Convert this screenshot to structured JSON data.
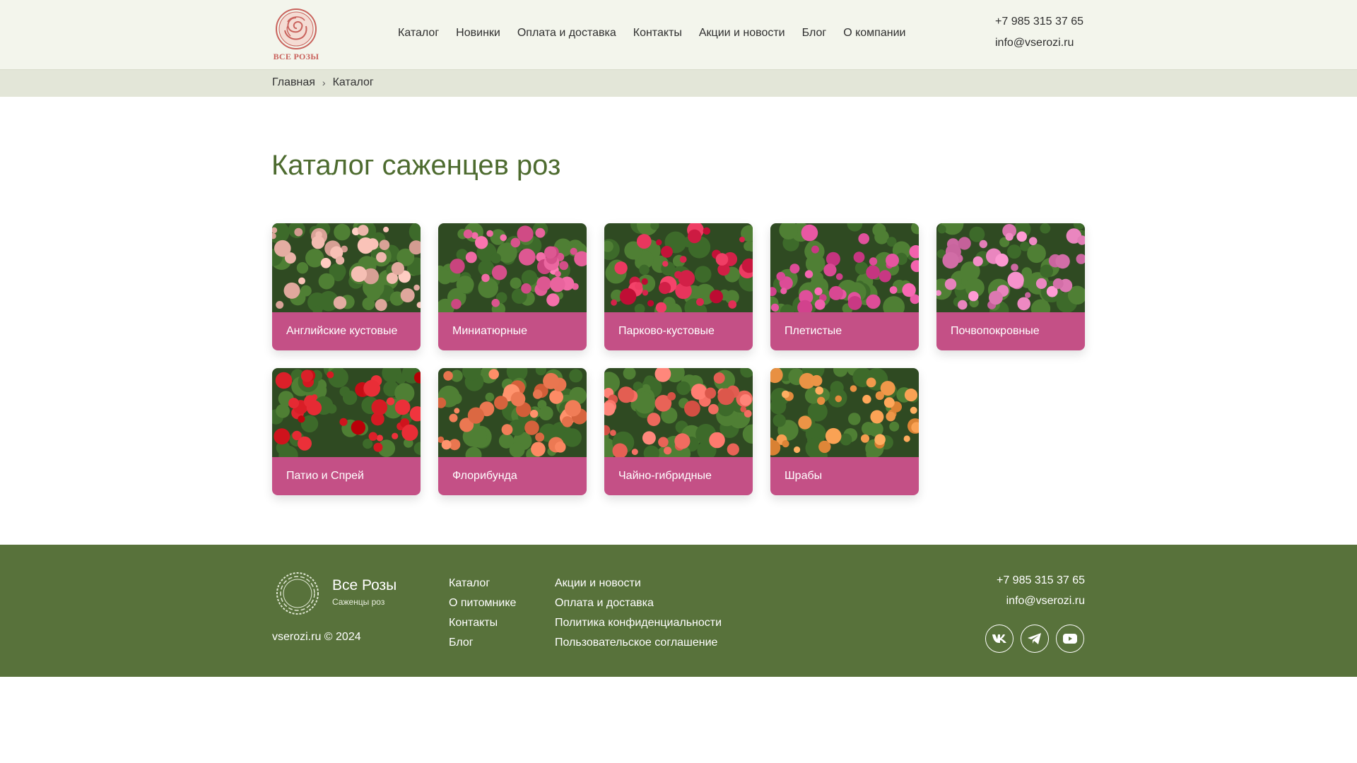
{
  "header": {
    "logo_text": "ВСЕ РОЗЫ",
    "nav": [
      "Каталог",
      "Новинки",
      "Оплата и доставка",
      "Контакты",
      "Акции и новости",
      "Блог",
      "О компании"
    ],
    "phone": "+7 985 315 37 65",
    "email": "info@vserozi.ru"
  },
  "breadcrumb": {
    "home": "Главная",
    "separator": "›",
    "current": "Каталог"
  },
  "page_title": "Каталог саженцев роз",
  "categories": [
    {
      "label": "Английские кустовые",
      "image": "light-pink-roses",
      "color": "#eab3a8"
    },
    {
      "label": "Миниатюрные",
      "image": "pink-miniature-roses",
      "color": "#e5609a"
    },
    {
      "label": "Парково-кустовые",
      "image": "red-park-roses",
      "color": "#d8264d"
    },
    {
      "label": "Плетистые",
      "image": "pink-climbing-roses",
      "color": "#e2529d"
    },
    {
      "label": "Почвопокровные",
      "image": "pink-groundcover-roses",
      "color": "#e37fb8"
    },
    {
      "label": "Патио и Спрей",
      "image": "red-patio-roses",
      "color": "#d51a23"
    },
    {
      "label": "Флорибунда",
      "image": "coral-floribunda-roses",
      "color": "#ee7b55"
    },
    {
      "label": "Чайно-гибридные",
      "image": "salmon-hybrid-tea-roses",
      "color": "#f06b5f"
    },
    {
      "label": "Шрабы",
      "image": "peach-shrub-roses",
      "color": "#f29a4c"
    }
  ],
  "footer": {
    "brand_name": "Все Розы",
    "brand_sub": "Саженцы роз",
    "copyright": "vserozi.ru © 2024",
    "col1": [
      "Каталог",
      "О питомнике",
      "Контакты",
      "Блог"
    ],
    "col2": [
      "Акции и новости",
      "Оплата и доставка",
      "Политика конфиденциальности",
      "Пользовательское соглашение"
    ],
    "phone": "+7 985 315 37 65",
    "email": "info@vserozi.ru",
    "socials": [
      "vk-icon",
      "telegram-icon",
      "youtube-icon"
    ]
  },
  "colors": {
    "accent": "#c45086",
    "title_green": "#4d6b2f",
    "footer_green": "#58723b",
    "header_bg": "#f3f5ec"
  }
}
